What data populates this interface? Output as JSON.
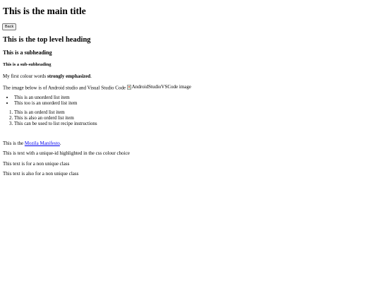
{
  "page": {
    "main_title": "This is the main title",
    "back_button": "Back",
    "top_heading": "This is the top level heading",
    "subheading": "This is a subheading",
    "sub_subheading": "This is a sub-subheading",
    "colour_words": {
      "prefix": "My first colour words ",
      "strong": "strongly emphasized",
      "suffix": "."
    },
    "image_line": {
      "text": "The image below is of Android studio and Visual Studio Code ",
      "image_alt": "AndroidStudioVSCode image"
    },
    "unordered_list": [
      "This is an unorderd list item",
      "This too is an unorderd list item"
    ],
    "ordered_list": [
      "This is an orderd list item",
      "This is also an orderd list item",
      "This can be used to list recipe instructions"
    ],
    "manifesto_line": {
      "prefix": "This is the ",
      "link_text": "Mozila Manifesto",
      "suffix": "."
    },
    "unique_id_text": "This is text with a unique-id highlighted in the css colour choice",
    "non_unique_1": "This text is for a non unique class",
    "non_unique_2": "This text is also for a non unique class"
  }
}
